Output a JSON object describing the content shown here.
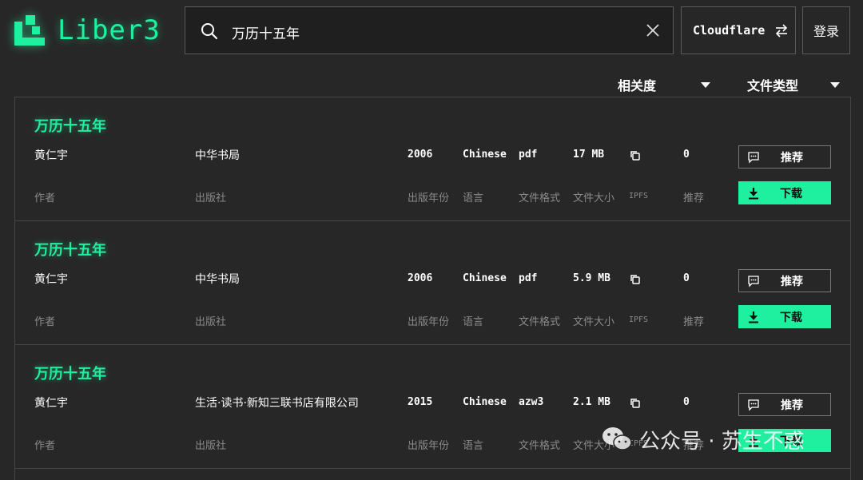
{
  "brand": {
    "name": "Liber3",
    "accent": "#1ff0a0"
  },
  "search": {
    "value": "万历十五年",
    "placeholder": ""
  },
  "gateway": {
    "label": "Cloudflare"
  },
  "login": {
    "label": "登录"
  },
  "sort": {
    "relevance": "相关度",
    "file_type": "文件类型"
  },
  "labels": {
    "author": "作者",
    "publisher": "出版社",
    "year": "出版年份",
    "language": "语言",
    "format": "文件格式",
    "size": "文件大小",
    "ipfs": "IPFS",
    "recommend_count": "推荐",
    "recommend_button": "推荐",
    "download_button": "下载"
  },
  "results": [
    {
      "title": "万历十五年",
      "author": "黄仁宇",
      "publisher": "中华书局",
      "year": "2006",
      "language": "Chinese",
      "format": "pdf",
      "size": "17 MB",
      "recommends": "0"
    },
    {
      "title": "万历十五年",
      "author": "黄仁宇",
      "publisher": "中华书局",
      "year": "2006",
      "language": "Chinese",
      "format": "pdf",
      "size": "5.9 MB",
      "recommends": "0"
    },
    {
      "title": "万历十五年",
      "author": "黄仁宇",
      "publisher": "生活·读书·新知三联书店有限公司",
      "year": "2015",
      "language": "Chinese",
      "format": "azw3",
      "size": "2.1 MB",
      "recommends": "0"
    }
  ],
  "watermark": {
    "text": "公众号 · 苏生不惑",
    "icon": "wechat-icon"
  }
}
